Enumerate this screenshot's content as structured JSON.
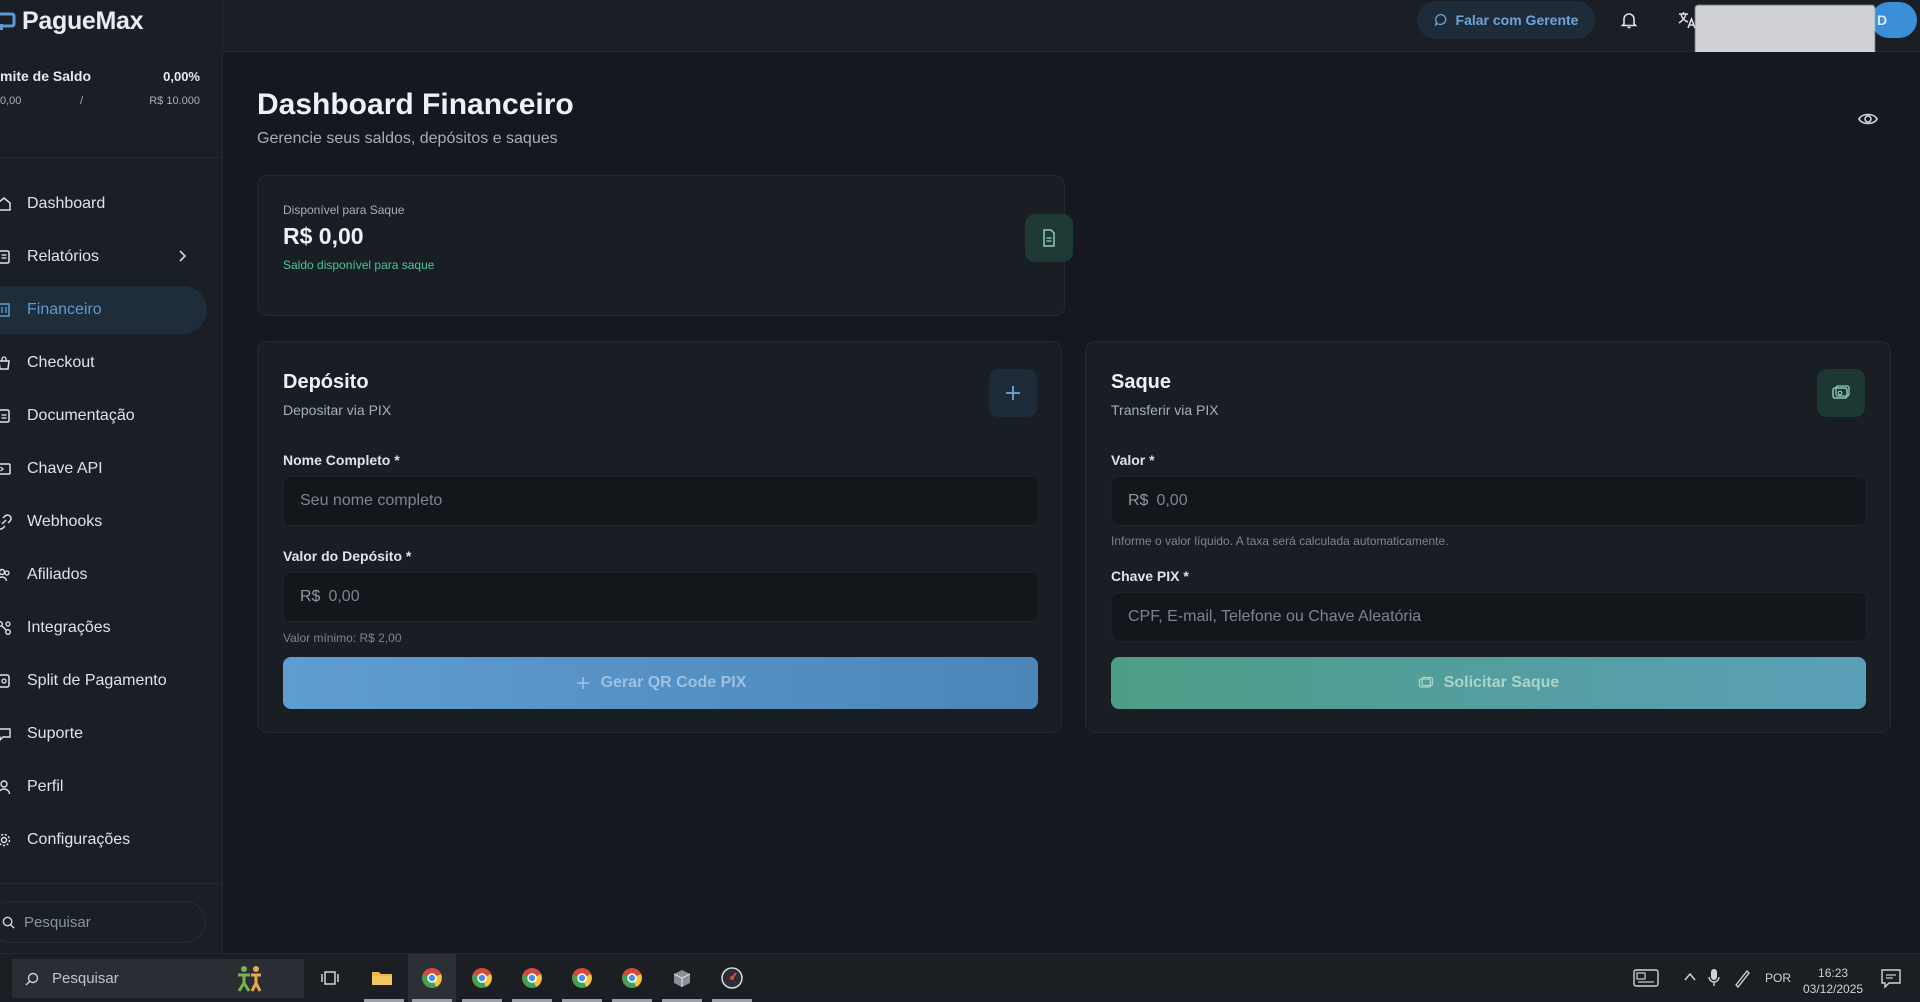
{
  "app": {
    "name": "PagueMax"
  },
  "sidebar": {
    "balance_limit": {
      "title": "mite de Saldo",
      "percent": "0,00%",
      "current": "0,00",
      "separator": "/",
      "max": "R$ 10.000"
    },
    "items": [
      {
        "label": "Dashboard",
        "icon": "home-icon"
      },
      {
        "label": "Relatórios",
        "icon": "report-icon"
      },
      {
        "label": "Financeiro",
        "icon": "bank-icon",
        "active": true
      },
      {
        "label": "Checkout",
        "icon": "bag-icon"
      },
      {
        "label": "Documentação",
        "icon": "document-icon"
      },
      {
        "label": "Chave API",
        "icon": "terminal-icon"
      },
      {
        "label": "Webhooks",
        "icon": "link-icon"
      },
      {
        "label": "Afiliados",
        "icon": "users-icon"
      },
      {
        "label": "Integrações",
        "icon": "integration-icon"
      },
      {
        "label": "Split de Pagamento",
        "icon": "split-icon"
      },
      {
        "label": "Suporte",
        "icon": "chat-icon"
      },
      {
        "label": "Perfil",
        "icon": "user-icon"
      },
      {
        "label": "Configurações",
        "icon": "gear-icon"
      }
    ],
    "search_placeholder": "Pesquisar"
  },
  "header": {
    "talk_button": "Falar com Gerente",
    "avatar_initial": "D"
  },
  "main": {
    "title": "Dashboard Financeiro",
    "subtitle": "Gerencie seus saldos, depósitos e saques",
    "available": {
      "label": "Disponível para Saque",
      "value": "R$ 0,00",
      "hint": "Saldo disponível para saque"
    },
    "deposit": {
      "title": "Depósito",
      "subtitle": "Depositar via PIX",
      "name_label": "Nome Completo *",
      "name_placeholder": "Seu nome completo",
      "value_label": "Valor do Depósito *",
      "currency_prefix": "R$",
      "value_placeholder": "0,00",
      "min_hint": "Valor mínimo: R$ 2,00",
      "button": "Gerar QR Code PIX"
    },
    "withdraw": {
      "title": "Saque",
      "subtitle": "Transferir via PIX",
      "value_label": "Valor *",
      "currency_prefix": "R$",
      "value_placeholder": "0,00",
      "value_hint": "Informe o valor líquido. A taxa será calculada automaticamente.",
      "pix_label": "Chave PIX *",
      "pix_placeholder": "CPF, E-mail, Telefone ou Chave Aleatória",
      "button": "Solicitar Saque"
    }
  },
  "taskbar": {
    "search_placeholder": "Pesquisar",
    "language": "POR",
    "time": "16:23",
    "date": "03/12/2025"
  },
  "colors": {
    "accent_blue": "#5b9bd5",
    "accent_green": "#4fc39a",
    "background": "#15191f",
    "panel": "#191e25"
  }
}
